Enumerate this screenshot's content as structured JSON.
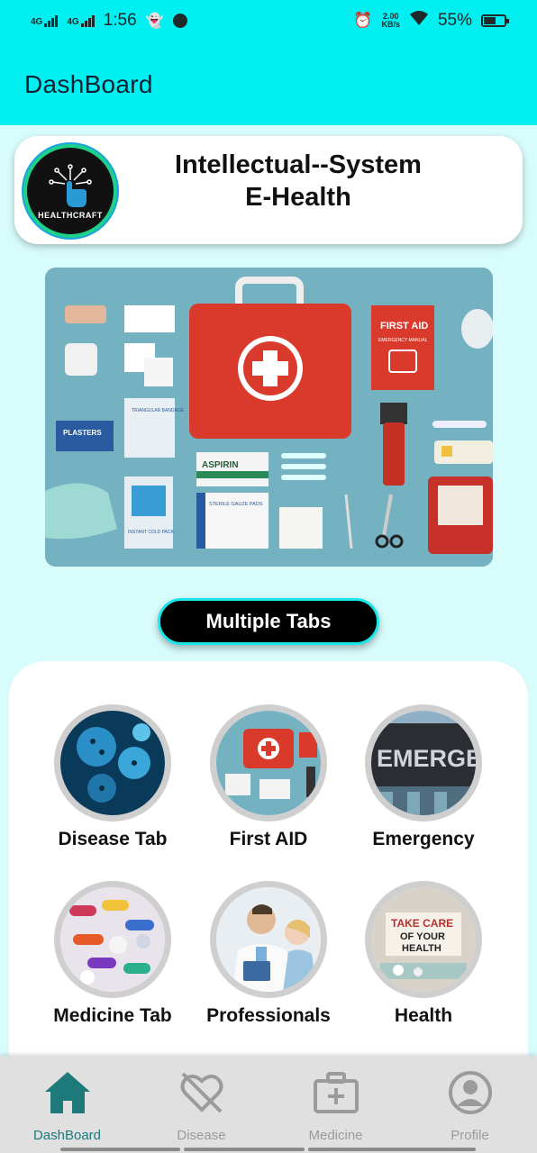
{
  "status_bar": {
    "network_1": "4G",
    "network_2": "4G",
    "time": "1:56",
    "speed_value": "2.00",
    "speed_unit": "KB/s",
    "battery": "55%"
  },
  "app_bar": {
    "title": "DashBoard"
  },
  "header_card": {
    "title_line1": "Intellectual--System",
    "title_line2": "E-Health",
    "logo_text": "HEALTHCRAFT"
  },
  "banner": {
    "labels": {
      "first_aid": "FIRST AID",
      "emergency_manual": "EMERGENCY MANUAL",
      "plasters": "PLASTERS",
      "aspirin": "ASPIRIN",
      "sterile_pads": "STERILE GAUZE PADS",
      "instant_cold_pack": "INSTANT COLD PACK",
      "triangular_bandage": "TRIANGULAR BANDAGE"
    }
  },
  "multiple_tabs_button": "Multiple Tabs",
  "tiles": [
    {
      "label": "Disease Tab",
      "icon": "virus-image"
    },
    {
      "label": "First AID",
      "icon": "first-aid-kit-image"
    },
    {
      "label": "Emergency",
      "icon": "emergency-sign-image"
    },
    {
      "label": "Medicine Tab",
      "icon": "pills-image"
    },
    {
      "label": "Professionals",
      "icon": "doctor-image"
    },
    {
      "label": "Health",
      "icon": "take-care-sign-image"
    }
  ],
  "tile_overlays": {
    "emergency_sign": "EMERGE",
    "health_sign_1": "TAKE CARE",
    "health_sign_2": "OF YOUR",
    "health_sign_3": "HEALTH"
  },
  "bottom_nav": [
    {
      "label": "DashBoard",
      "icon": "home-icon",
      "active": true
    },
    {
      "label": "Disease",
      "icon": "heart-off-icon",
      "active": false
    },
    {
      "label": "Medicine",
      "icon": "medical-kit-icon",
      "active": false
    },
    {
      "label": "Profile",
      "icon": "user-circle-icon",
      "active": false
    }
  ],
  "colors": {
    "app_bar": "#00f0f2",
    "background": "#d8fbfb",
    "active_nav": "#1e7a7a",
    "inactive_nav": "#9b9b9b",
    "button_border": "#17e6ea"
  }
}
